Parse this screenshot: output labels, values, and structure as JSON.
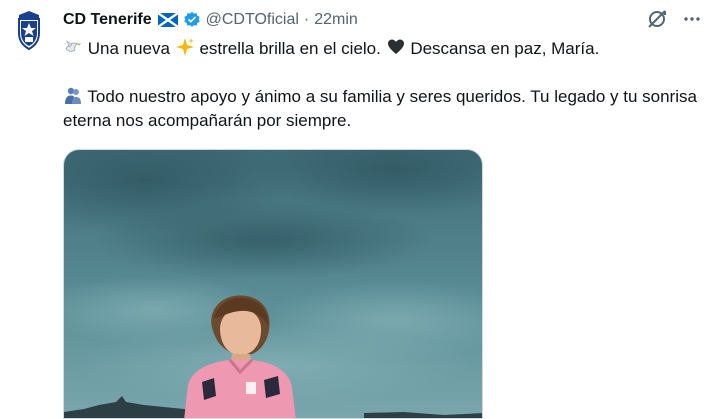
{
  "tweet": {
    "author_name": "CD Tenerife",
    "handle": "@CDTOficial",
    "separator": "·",
    "time": "22min",
    "line1_part1": "Una nueva",
    "line1_part2": "estrella brilla en el cielo.",
    "line1_part3": "Descansa en paz, María.",
    "line2": "Todo nuestro apoyo y ánimo a su familia y seres queridos. Tu legado y tu sonrisa eterna nos acompañarán por siempre."
  },
  "icons": {
    "avatar": "cd-tenerife-crest-icon",
    "flag": "scotland-flag-icon",
    "verified": "verified-badge-icon",
    "grok": "grok-icon",
    "more": "more-icon",
    "dove": "dove-emoji-icon",
    "sparkles": "sparkles-emoji-icon",
    "heart": "black-heart-emoji-icon",
    "people": "people-hugging-emoji-icon"
  },
  "colors": {
    "text": "#0f1419",
    "secondary": "#536471",
    "verified": "#1d9bf0",
    "sky": "#4f7f88"
  }
}
